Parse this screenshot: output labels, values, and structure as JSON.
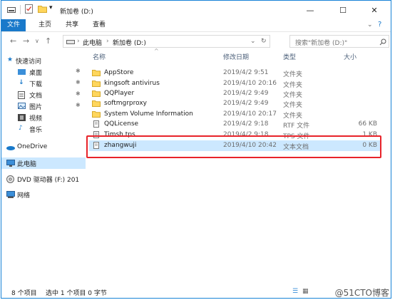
{
  "title": "新加卷 (D:)",
  "ribbon_tabs": [
    "文件",
    "主页",
    "共享",
    "查看"
  ],
  "address": {
    "crumb1": "此电脑",
    "crumb2": "新加卷 (D:)"
  },
  "search": {
    "placeholder": "搜索\"新加卷 (D:)\""
  },
  "sidebar": {
    "quick_access": "快速访问",
    "items": [
      "桌面",
      "下载",
      "文档",
      "图片",
      "视频",
      "音乐"
    ],
    "onedrive": "OneDrive",
    "this_pc": "此电脑",
    "dvd": "DVD 驱动器 (F:) 201",
    "network": "网络"
  },
  "columns": {
    "name": "名称",
    "date": "修改日期",
    "type": "类型",
    "size": "大小"
  },
  "files": [
    {
      "name": "AppStore",
      "date": "2019/4/2 9:51",
      "type": "文件夹",
      "size": "",
      "icon": "folder-icon"
    },
    {
      "name": "kingsoft antivirus",
      "date": "2019/4/10 20:16",
      "type": "文件夹",
      "size": "",
      "icon": "folder-icon"
    },
    {
      "name": "QQPlayer",
      "date": "2019/4/2 9:49",
      "type": "文件夹",
      "size": "",
      "icon": "folder-icon"
    },
    {
      "name": "softmgrproxy",
      "date": "2019/4/2 9:49",
      "type": "文件夹",
      "size": "",
      "icon": "folder-icon"
    },
    {
      "name": "System Volume Information",
      "date": "2019/4/10 20:17",
      "type": "文件夹",
      "size": "",
      "icon": "folder-icon"
    },
    {
      "name": "QQLicense",
      "date": "2019/4/2 9:18",
      "type": "RTF 文件",
      "size": "66 KB",
      "icon": "document-icon"
    },
    {
      "name": "Timsh.tps",
      "date": "2019/4/2 9:18",
      "type": "TPS 文件",
      "size": "1 KB",
      "icon": "document-icon"
    },
    {
      "name": "zhangwuji",
      "date": "2019/4/10 20:42",
      "type": "文本文档",
      "size": "0 KB",
      "icon": "text-file-icon"
    }
  ],
  "status": {
    "count": "8 个项目",
    "selected": "选中 1 个项目 0 字节"
  },
  "watermark": "@51CTO博客",
  "colors": {
    "accent": "#1979ca",
    "selection": "#cce8ff",
    "highlight": "#e8232a",
    "folder": "#ffd65c"
  }
}
